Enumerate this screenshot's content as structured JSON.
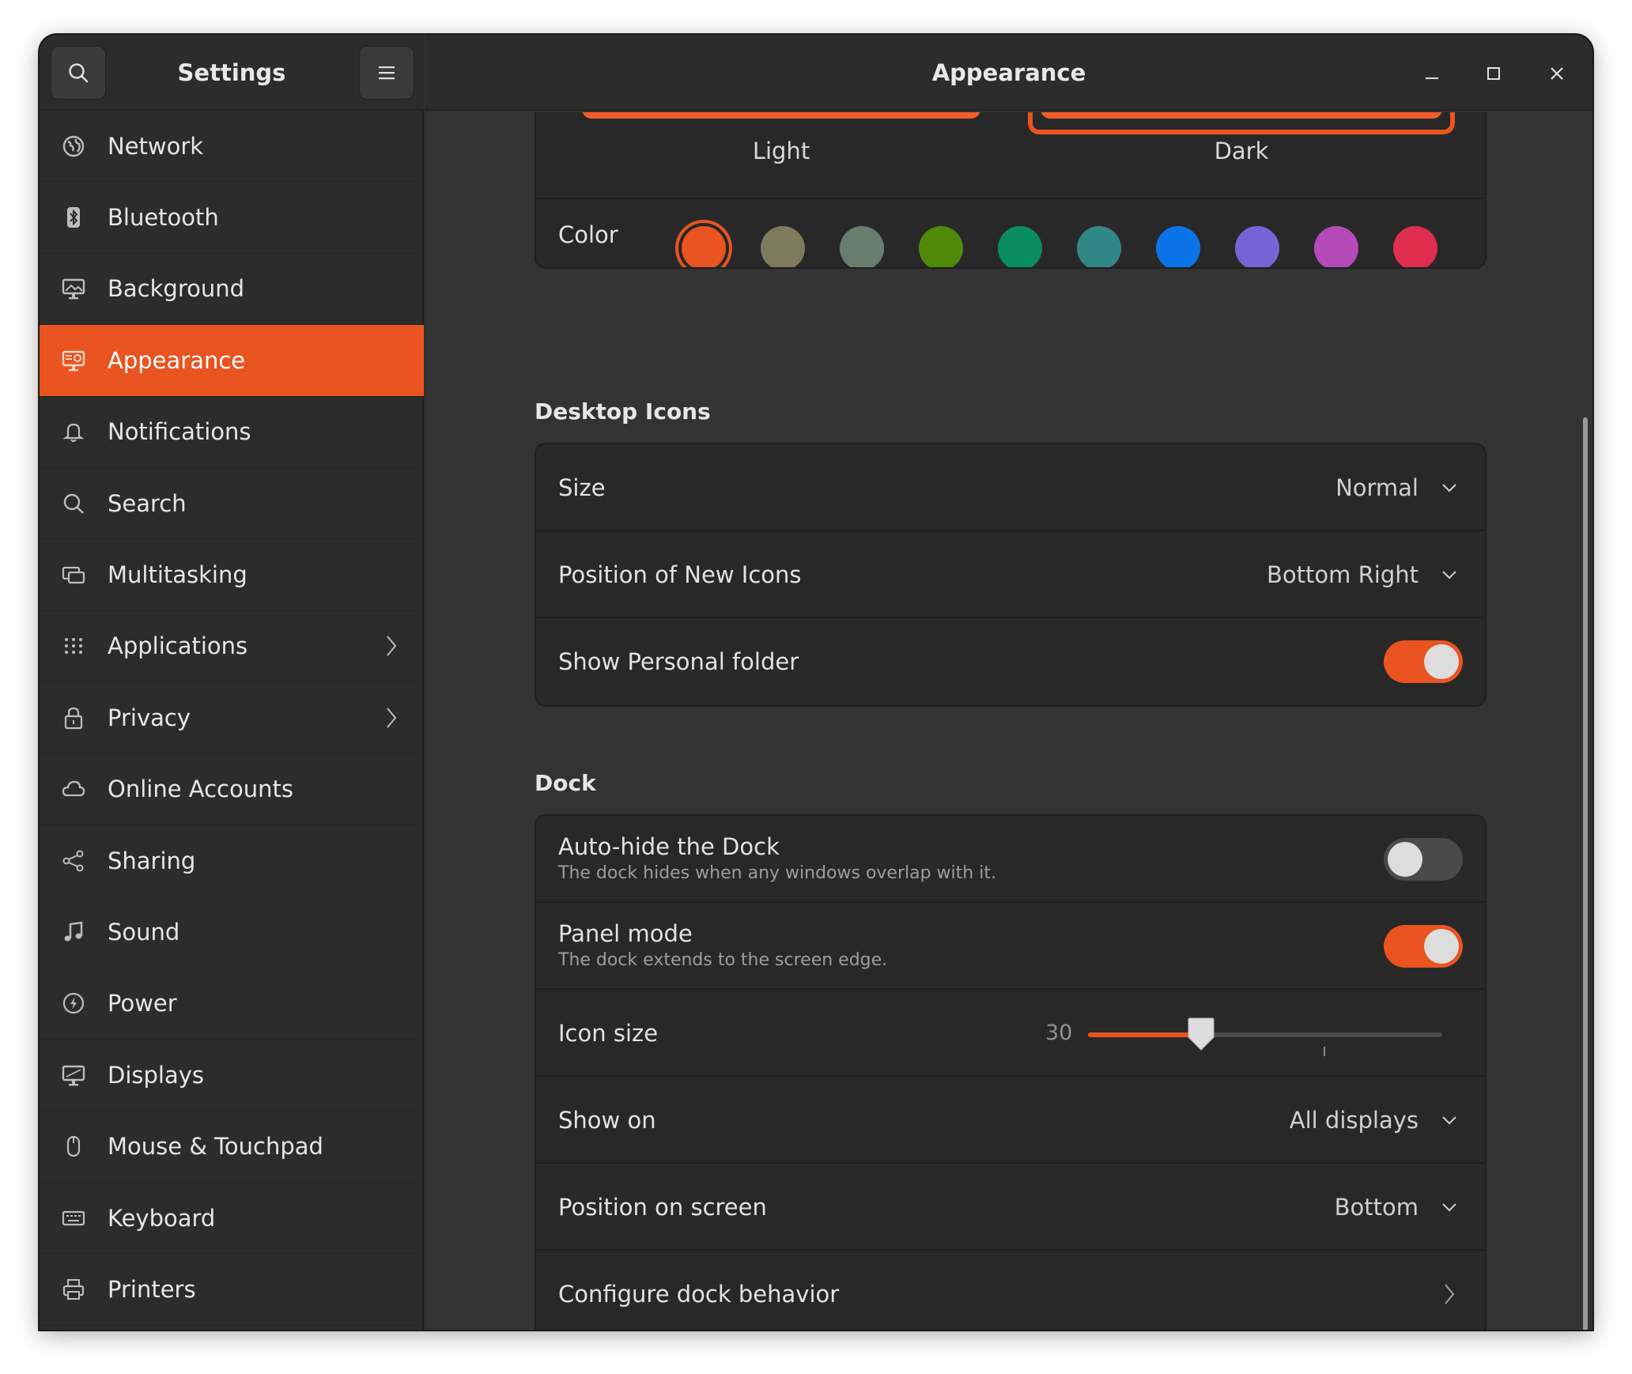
{
  "sidebar": {
    "title": "Settings",
    "items": [
      {
        "label": "Network",
        "icon": "globe-icon",
        "arrow": false,
        "active": false
      },
      {
        "label": "Bluetooth",
        "icon": "bluetooth-icon",
        "arrow": false,
        "active": false
      },
      {
        "label": "Background",
        "icon": "monitor-background-icon",
        "arrow": false,
        "active": false
      },
      {
        "label": "Appearance",
        "icon": "appearance-icon",
        "arrow": false,
        "active": true
      },
      {
        "label": "Notifications",
        "icon": "bell-icon",
        "arrow": false,
        "active": false
      },
      {
        "label": "Search",
        "icon": "search-icon",
        "arrow": false,
        "active": false
      },
      {
        "label": "Multitasking",
        "icon": "multitasking-icon",
        "arrow": false,
        "active": false
      },
      {
        "label": "Applications",
        "icon": "apps-grid-icon",
        "arrow": true,
        "active": false
      },
      {
        "label": "Privacy",
        "icon": "lock-icon",
        "arrow": true,
        "active": false
      },
      {
        "label": "Online Accounts",
        "icon": "cloud-icon",
        "arrow": false,
        "active": false
      },
      {
        "label": "Sharing",
        "icon": "share-icon",
        "arrow": false,
        "active": false
      },
      {
        "label": "Sound",
        "icon": "music-note-icon",
        "arrow": false,
        "active": false
      },
      {
        "label": "Power",
        "icon": "power-icon",
        "arrow": false,
        "active": false
      },
      {
        "label": "Displays",
        "icon": "display-icon",
        "arrow": false,
        "active": false
      },
      {
        "label": "Mouse & Touchpad",
        "icon": "mouse-icon",
        "arrow": false,
        "active": false
      },
      {
        "label": "Keyboard",
        "icon": "keyboard-icon",
        "arrow": false,
        "active": false
      },
      {
        "label": "Printers",
        "icon": "printer-icon",
        "arrow": false,
        "active": false
      }
    ]
  },
  "header": {
    "title": "Appearance"
  },
  "style": {
    "options": [
      "Light",
      "Dark"
    ],
    "selected": "Dark",
    "color_label": "Color",
    "colors": [
      "#e95420",
      "#7d7b5c",
      "#677e6f",
      "#4e8a08",
      "#098d5e",
      "#318785",
      "#0b73e9",
      "#7663d5",
      "#b44ab7",
      "#df2d4d"
    ],
    "selected_color": "#e95420"
  },
  "desktop_icons": {
    "title": "Desktop Icons",
    "size_label": "Size",
    "size_value": "Normal",
    "position_label": "Position of New Icons",
    "position_value": "Bottom Right",
    "personal_label": "Show Personal folder",
    "personal_on": true
  },
  "dock": {
    "title": "Dock",
    "autohide_label": "Auto-hide the Dock",
    "autohide_sub": "The dock hides when any windows overlap with it.",
    "autohide_on": false,
    "panel_label": "Panel mode",
    "panel_sub": "The dock extends to the screen edge.",
    "panel_on": true,
    "icon_size_label": "Icon size",
    "icon_size_value": "30",
    "icon_size_fraction": 0.32,
    "show_on_label": "Show on",
    "show_on_value": "All displays",
    "position_label": "Position on screen",
    "position_value": "Bottom",
    "configure_label": "Configure dock behavior"
  },
  "colors": {
    "accent": "#e95420",
    "bg": "#303030",
    "card": "#282828"
  }
}
